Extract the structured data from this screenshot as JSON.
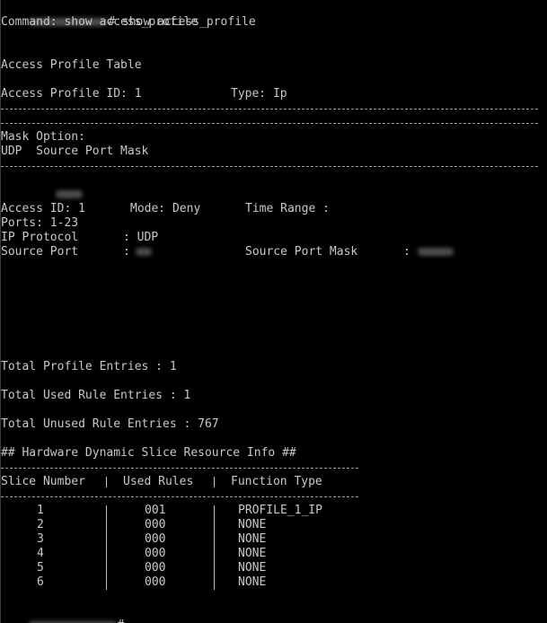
{
  "terminal": {
    "prompt_symbol": "#",
    "command_input": "show access_profile",
    "command_echo": "Command: show access_profile",
    "table_title": "Access Profile Table",
    "profile": {
      "id_label": "Access Profile ID: 1",
      "type_label": "Type: Ip"
    },
    "mask_option_label": "Mask Option:",
    "mask_value": "UDP  Source Port Mask",
    "rule": {
      "access_id": "Access ID: 1",
      "mode": "Mode: Deny",
      "time_range": "Time Range :",
      "ports": "Ports: 1-23",
      "ip_protocol_label": "IP Protocol",
      "ip_protocol_value": ": UDP",
      "source_port_label": "Source Port",
      "source_port_colon": ":",
      "source_port_mask_label": "Source Port Mask",
      "source_port_mask_colon": ":"
    },
    "summary": {
      "total_profile": "Total Profile Entries : 1",
      "total_used": "Total Used Rule Entries : 1",
      "total_unused": "Total Unused Rule Entries : 767"
    },
    "slice_header": "## Hardware Dynamic Slice Resource Info ##",
    "slice_table": {
      "columns": [
        "Slice Number",
        "Used Rules",
        "Function Type"
      ],
      "rows": [
        {
          "slice": "1",
          "used": "001",
          "function": "PROFILE_1_IP"
        },
        {
          "slice": "2",
          "used": "000",
          "function": "NONE"
        },
        {
          "slice": "3",
          "used": "000",
          "function": "NONE"
        },
        {
          "slice": "4",
          "used": "000",
          "function": "NONE"
        },
        {
          "slice": "5",
          "used": "000",
          "function": "NONE"
        },
        {
          "slice": "6",
          "used": "000",
          "function": "NONE"
        }
      ]
    }
  },
  "colors": {
    "background": "#000000",
    "text": "#c8c8c8"
  }
}
